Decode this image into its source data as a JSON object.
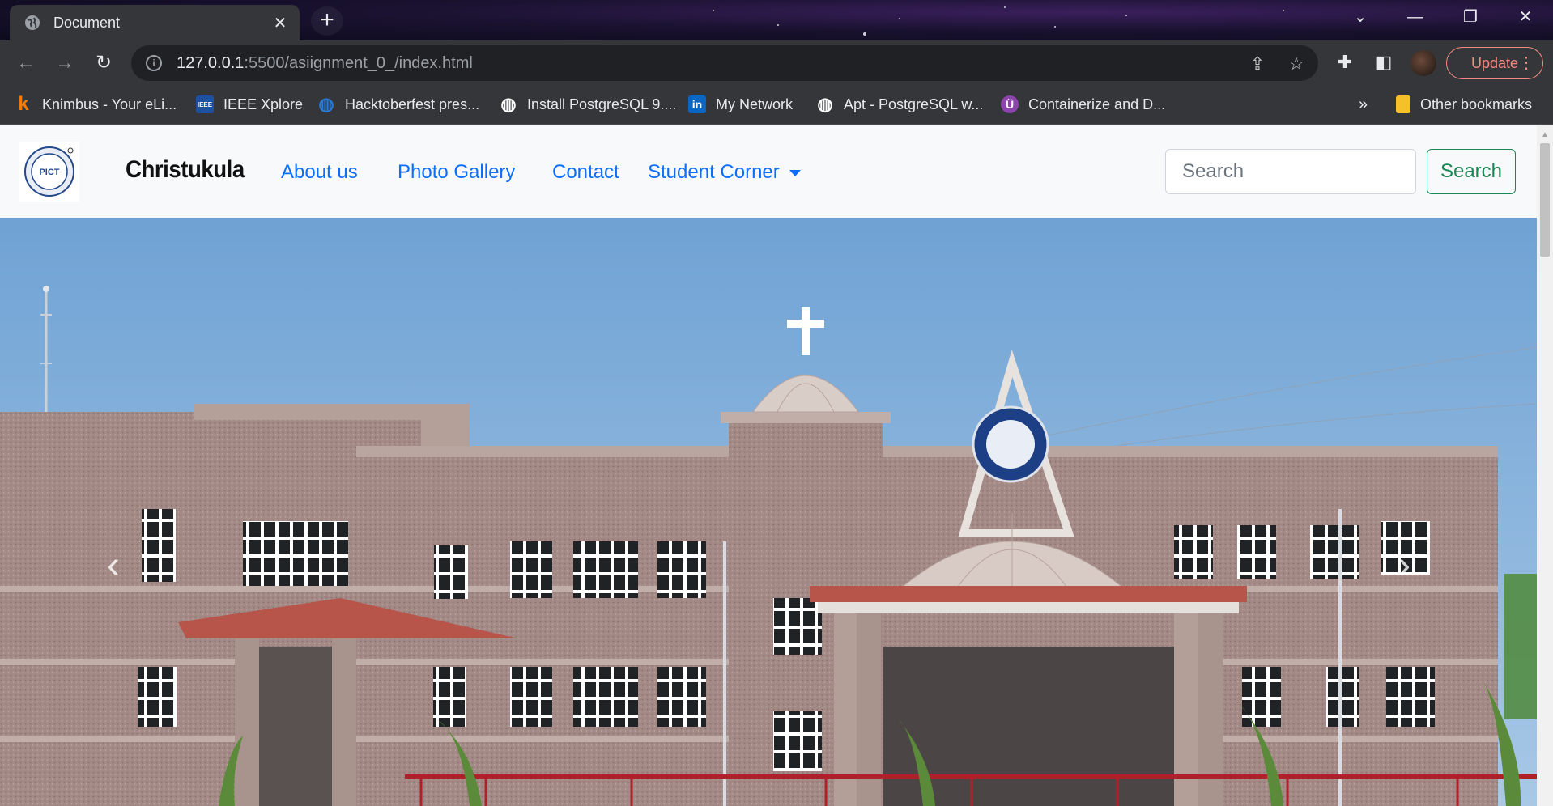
{
  "browser": {
    "tab_title": "Document",
    "tab_close": "✕",
    "new_tab": "+",
    "url_host": "127.0.0.1",
    "url_path": ":5500/asiignment_0_/index.html",
    "update_label": "Update",
    "bookmarks": [
      {
        "label": "Knimbus - Your eLi...",
        "icon": "k",
        "color": "#f57c00"
      },
      {
        "label": "IEEE Xplore",
        "icon": "IEEE",
        "color": "#1e50a0"
      },
      {
        "label": "Hacktoberfest pres...",
        "icon": "◍",
        "color": "#2b7bd6"
      },
      {
        "label": "Install PostgreSQL 9....",
        "icon": "◍",
        "color": "#ffffff"
      },
      {
        "label": "My Network",
        "icon": "in",
        "color": "#0a66c2"
      },
      {
        "label": "Apt - PostgreSQL w...",
        "icon": "◍",
        "color": "#ffffff"
      },
      {
        "label": "Containerize and D...",
        "icon": "Ü",
        "color": "#8e44ad"
      }
    ],
    "bookmarks_overflow": "»",
    "other_bookmarks": "Other bookmarks"
  },
  "site": {
    "logo_text": "PICT",
    "brand": "Christukula",
    "nav": {
      "about": "About us",
      "gallery": "Photo Gallery",
      "contact": "Contact",
      "student_corner": "Student Corner"
    },
    "search_placeholder": "Search",
    "search_button": "Search",
    "carousel_prev": "‹",
    "carousel_next": "›"
  }
}
